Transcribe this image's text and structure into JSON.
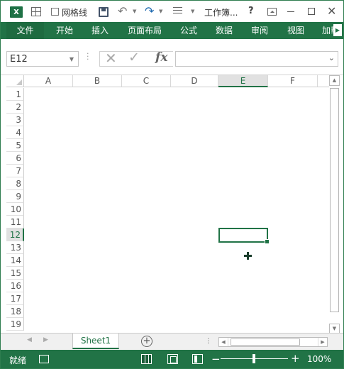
{
  "titlebar": {
    "app_icon_label": "X",
    "gridlines_label": "网格线",
    "gridlines_checked": false,
    "title": "工作簿...",
    "help": "?",
    "close": "✕",
    "undo": "↶",
    "redo": "↷"
  },
  "ribbon": {
    "tabs": [
      "文件",
      "开始",
      "插入",
      "页面布局",
      "公式",
      "数据",
      "审阅",
      "视图",
      "加载"
    ],
    "active_tab": "文件"
  },
  "formula_bar": {
    "name_box": "E12",
    "formula_value": "",
    "cancel_glyph": "✕",
    "enter_glyph": "✓",
    "fx_label": "fx"
  },
  "grid": {
    "columns": [
      "A",
      "B",
      "C",
      "D",
      "E",
      "F"
    ],
    "rows": [
      "1",
      "2",
      "3",
      "4",
      "5",
      "6",
      "7",
      "8",
      "9",
      "10",
      "11",
      "12",
      "13",
      "14",
      "15",
      "16",
      "17",
      "18",
      "19"
    ],
    "selected_cell": "E12",
    "selected_column": "E",
    "selected_row": "12"
  },
  "sheets": {
    "tabs": [
      "Sheet1"
    ],
    "active": "Sheet1",
    "add_glyph": "+"
  },
  "statusbar": {
    "ready": "就绪",
    "zoom": "100%",
    "zoom_level": 1.0,
    "zoom_minus": "−",
    "zoom_plus": "+"
  },
  "colors": {
    "accent": "#217346",
    "selection": "#217346"
  },
  "icons": [
    "excel-logo-icon",
    "gridlines-toggle-icon",
    "save-icon",
    "undo-icon",
    "redo-icon",
    "customize-qat-icon",
    "help-icon",
    "ribbon-display-options-icon",
    "minimize-icon",
    "maximize-icon",
    "close-icon",
    "add-sheet-icon",
    "macro-record-icon",
    "normal-view-icon",
    "page-layout-view-icon",
    "page-break-view-icon"
  ]
}
